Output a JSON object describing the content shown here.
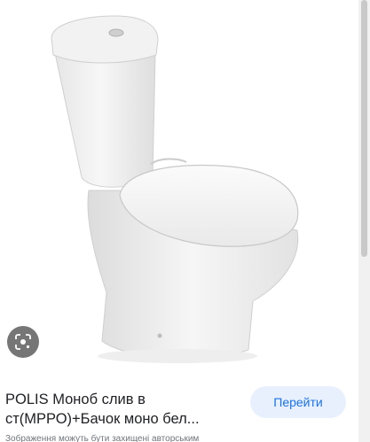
{
  "product": {
    "title": "POLIS Моноб слив в ст(МРРО)+Бачок моно бел...",
    "image_alt_icon": "toilet-product-image"
  },
  "actions": {
    "go_label": "Перейти",
    "lens_icon": "lens-icon"
  },
  "footer": {
    "disclaimer": "Зображення можуть бути захищені авторським"
  },
  "colors": {
    "button_bg": "#e8f0fe",
    "button_text": "#1a73e8",
    "title_text": "#202124",
    "disclaimer_text": "#70757a"
  }
}
